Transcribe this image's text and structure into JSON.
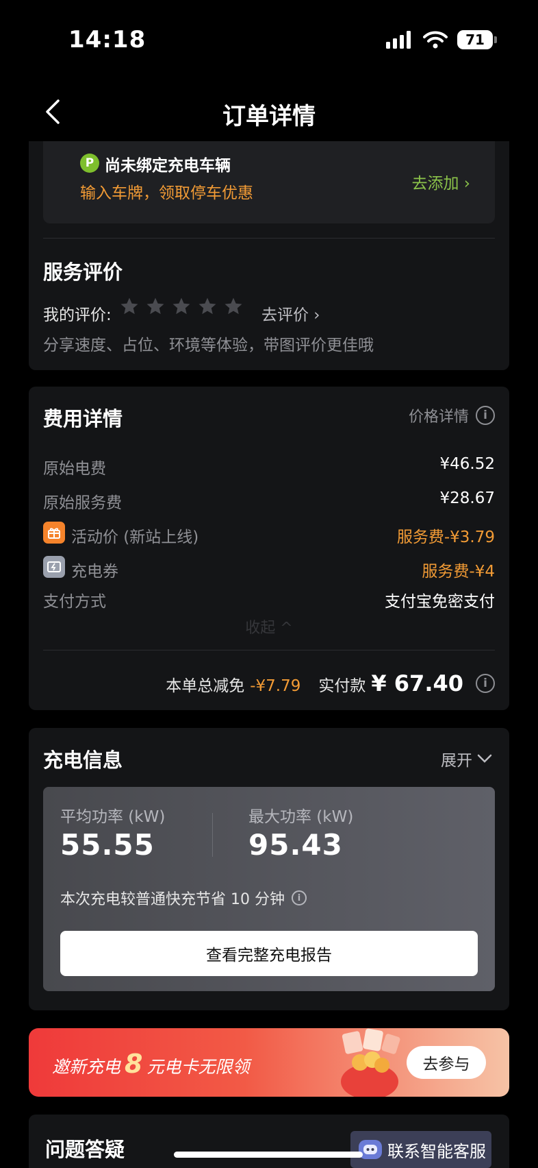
{
  "status_bar": {
    "time": "14:18",
    "battery": "71"
  },
  "nav": {
    "title": "订单详情"
  },
  "vehicle": {
    "badge": "P",
    "title": "尚未绑定充电车辆",
    "subtitle": "输入车牌，领取停车优惠",
    "add_link": "去添加 ›"
  },
  "review": {
    "title": "服务评价",
    "my_review_label": "我的评价:",
    "stars_total": 5,
    "stars_filled": 0,
    "review_link": "去评价 ›",
    "hint": "分享速度、占位、环境等体验，带图评价更佳哦"
  },
  "fees": {
    "title": "费用详情",
    "price_detail_link": "价格详情",
    "rows": [
      {
        "label": "原始电费",
        "value": "¥46.52"
      },
      {
        "label": "原始服务费",
        "value": "¥28.67"
      },
      {
        "label": "活动价 (新站上线)",
        "value": "服务费-¥3.79"
      },
      {
        "label": "充电券",
        "value": "服务费-¥4"
      },
      {
        "label": "支付方式",
        "value": "支付宝免密支付"
      }
    ],
    "collapse_label": "收起 ^",
    "discount_label": "本单总减免",
    "discount_value": "-¥7.79",
    "paid_label": "实付款",
    "paid_value": "¥ 67.40"
  },
  "charging": {
    "title": "充电信息",
    "expand_label": "展开",
    "avg_power_label": "平均功率 (kW)",
    "avg_power_value": "55.55",
    "max_power_label": "最大功率 (kW)",
    "max_power_value": "95.43",
    "saving_text": "本次充电较普通快充节省 10 分钟",
    "report_button": "查看完整充电报告"
  },
  "banner": {
    "prefix": "邀新充电",
    "big": "8",
    "suffix": "元电卡无限领",
    "button": "去参与"
  },
  "faq": {
    "title": "问题答疑"
  },
  "customer_service": {
    "label": "联系智能客服"
  },
  "colors": {
    "accent_orange": "#f29b35",
    "accent_green": "#8bc34a",
    "background": "#000000",
    "card": "#141517"
  },
  "icons": [
    "cellular-icon",
    "wifi-icon",
    "battery-icon",
    "back-arrow-icon",
    "parking-icon",
    "star-icon",
    "info-icon",
    "gift-icon",
    "coupon-icon",
    "chevron-down-icon",
    "robot-icon"
  ]
}
